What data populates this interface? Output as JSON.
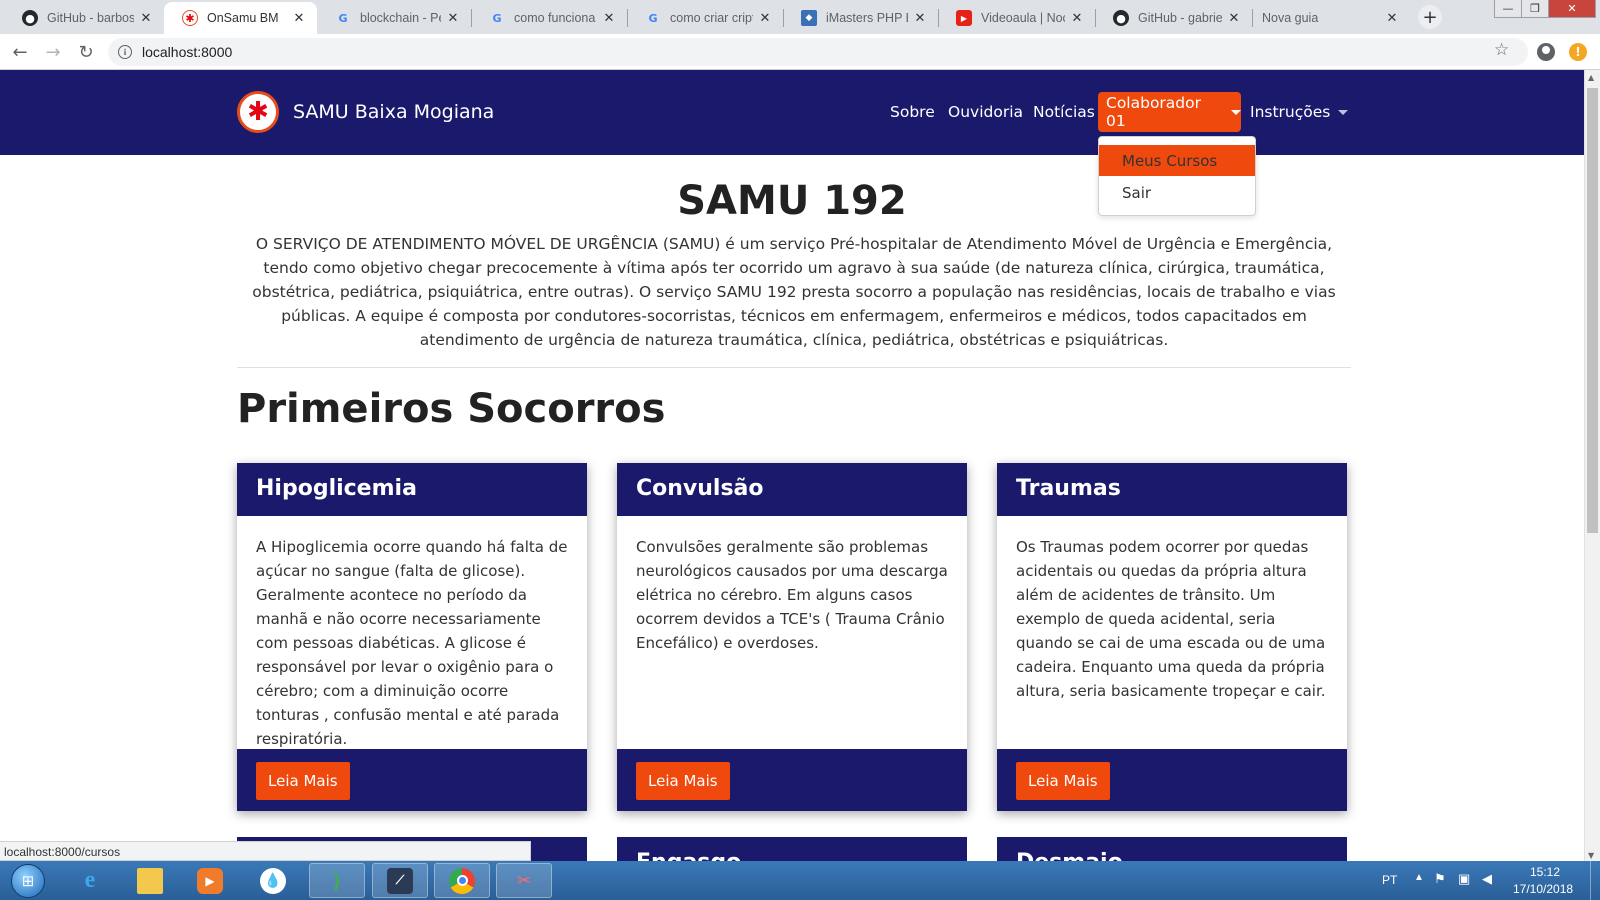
{
  "browser": {
    "tabs": [
      {
        "title": "GitHub - barbosa",
        "icon": "github-icon"
      },
      {
        "title": "OnSamu BM",
        "icon": "samu-icon",
        "active": true
      },
      {
        "title": "blockchain - Peso",
        "icon": "google-icon"
      },
      {
        "title": "como funciona cr",
        "icon": "google-icon"
      },
      {
        "title": "como criar cripto",
        "icon": "google-icon"
      },
      {
        "title": "iMasters PHP Exp",
        "icon": "imasters-icon"
      },
      {
        "title": "Videoaula | Noçõ",
        "icon": "youtube-icon"
      },
      {
        "title": "GitHub - gabrielr",
        "icon": "github-icon"
      },
      {
        "title": "Nova guia",
        "icon": ""
      }
    ],
    "url": "localhost:8000",
    "status_url": "localhost:8000/cursos"
  },
  "navbar": {
    "brand": "SAMU Baixa Mogiana",
    "links": {
      "sobre": "Sobre",
      "ouvidoria": "Ouvidoria",
      "noticias": "Notícias",
      "colaborador": "Colaborador 01",
      "instrucoes": "Instruções"
    },
    "dropdown": {
      "items": [
        "Meus Cursos",
        "Sair"
      ],
      "active_index": 0
    }
  },
  "hero": {
    "title": "SAMU 192",
    "text": "O SERVIÇO DE ATENDIMENTO MÓVEL DE URGÊNCIA (SAMU) é um serviço Pré-hospitalar de Atendimento Móvel de Urgência e Emergência, tendo como objetivo chegar precocemente à vítima após ter ocorrido um agravo à sua saúde (de natureza clínica, cirúrgica, traumática, obstétrica, pediátrica, psiquiátrica, entre outras). O serviço SAMU 192 presta socorro a população nas residências, locais de trabalho e vias públicas. A equipe é composta por condutores-socorristas, técnicos em enfermagem, enfermeiros e médicos, todos capacitados em atendimento de urgência de natureza traumática, clínica, pediátrica, obstétricas e psiquiátricas."
  },
  "section": {
    "title": "Primeiros Socorros",
    "cards": [
      {
        "title": "Hipoglicemia",
        "text": "A Hipoglicemia ocorre quando há falta de açúcar no sangue (falta de glicose). Geralmente acontece no período da manhã e não ocorre necessariamente com pessoas diabéticas. A glicose é responsável por levar o oxigênio para o cérebro; com a diminuição ocorre tonturas , confusão mental e até parada respiratória.",
        "button": "Leia Mais"
      },
      {
        "title": "Convulsão",
        "text": "Convulsões geralmente são problemas neurológicos causados por uma descarga elétrica no cérebro. Em alguns casos ocorrem devidos a TCE's ( Trauma Crânio Encefálico) e overdoses.",
        "button": "Leia Mais"
      },
      {
        "title": "Traumas",
        "text": "Os Traumas podem ocorrer por quedas acidentais ou quedas da própria altura além de acidentes de trânsito. Um exemplo de queda acidental, seria quando se cai de uma escada ou de uma cadeira. Enquanto uma queda da própria altura, seria basicamente tropeçar e cair.",
        "button": "Leia Mais"
      }
    ],
    "next_cards": [
      "",
      "Engasgo",
      "Desmaio"
    ]
  },
  "taskbar": {
    "language": "PT",
    "time": "15:12",
    "date": "17/10/2018"
  },
  "colors": {
    "navy": "#1a196c",
    "accent": "#f0490d"
  }
}
